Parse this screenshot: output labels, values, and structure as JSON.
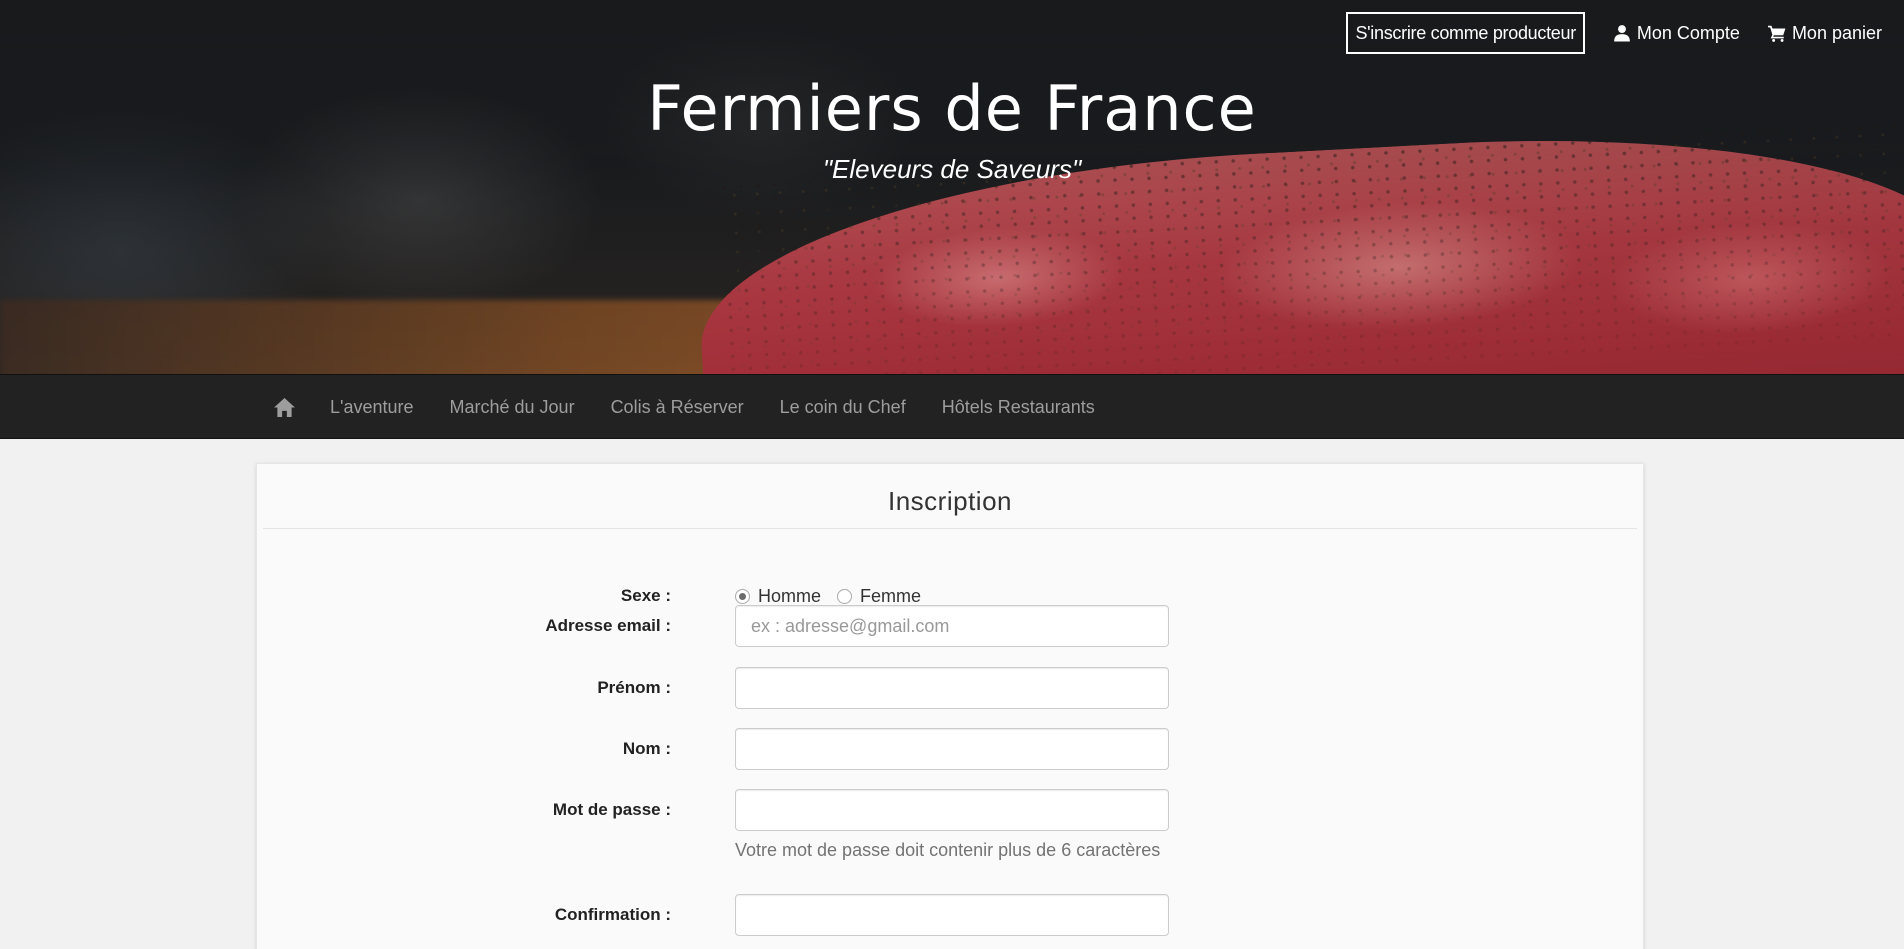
{
  "header": {
    "producer_button": "S'inscrire comme producteur",
    "account_link": "Mon Compte",
    "cart_link": "Mon panier",
    "site_title": "Fermiers de France",
    "tagline": "\"Eleveurs de Saveurs\""
  },
  "nav": {
    "home_icon": "home-icon",
    "items": [
      {
        "label": "L'aventure"
      },
      {
        "label": "Marché du Jour"
      },
      {
        "label": "Colis à Réserver"
      },
      {
        "label": "Le coin du Chef"
      },
      {
        "label": "Hôtels Restaurants"
      }
    ]
  },
  "form": {
    "title": "Inscription",
    "sexe": {
      "label": "Sexe :",
      "options": [
        "Homme",
        "Femme"
      ],
      "selected": "Homme"
    },
    "email": {
      "label": "Adresse email :",
      "placeholder": "ex : adresse@gmail.com",
      "value": ""
    },
    "prenom": {
      "label": "Prénom :",
      "value": ""
    },
    "nom": {
      "label": "Nom :",
      "value": ""
    },
    "password": {
      "label": "Mot de passe :",
      "value": "",
      "help": "Votre mot de passe doit contenir plus de 6 caractères"
    },
    "confirmation": {
      "label": "Confirmation :",
      "value": ""
    }
  },
  "icons": {
    "account": "user-icon",
    "cart": "cart-icon"
  }
}
